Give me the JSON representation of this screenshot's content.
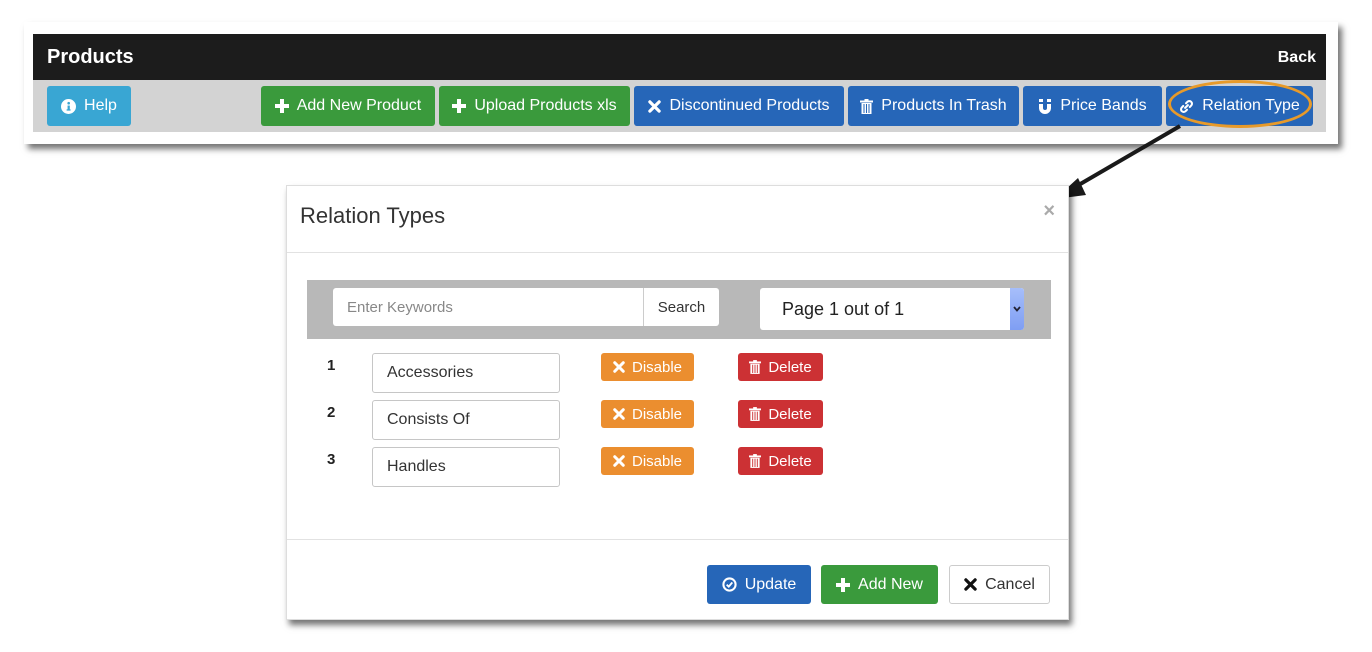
{
  "top": {
    "title": "Products",
    "back_label": "Back",
    "help_label": "Help",
    "toolbar": [
      {
        "label": "Add New Product",
        "icon": "plus-icon",
        "glyph": "✚",
        "style": "success"
      },
      {
        "label": "Upload Products xls",
        "icon": "plus-icon",
        "glyph": "✚",
        "style": "success"
      },
      {
        "label": "Discontinued Products",
        "icon": "close-icon",
        "glyph": "✖",
        "style": "primary"
      },
      {
        "label": "Products In Trash",
        "icon": "trash-icon",
        "glyph": "🗑",
        "style": "primary"
      },
      {
        "label": "Price Bands",
        "icon": "magnet-icon",
        "glyph": "Ü",
        "style": "primary"
      },
      {
        "label": "Relation Type",
        "icon": "link-icon",
        "glyph": "🔗",
        "style": "primary"
      }
    ]
  },
  "modal": {
    "title": "Relation Types",
    "close_glyph": "×",
    "search": {
      "placeholder": "Enter Keywords",
      "value": "",
      "button_label": "Search"
    },
    "pagination": {
      "selected": "Page 1 out of 1"
    },
    "rows": [
      {
        "num": "1",
        "value": "Accessories"
      },
      {
        "num": "2",
        "value": "Consists Of"
      },
      {
        "num": "3",
        "value": "Handles"
      }
    ],
    "row_actions": {
      "disable_label": "Disable",
      "delete_label": "Delete"
    },
    "footer": {
      "update_label": "Update",
      "add_new_label": "Add New",
      "cancel_label": "Cancel"
    }
  },
  "annotation": {
    "highlight_color": "#e79a2a",
    "target": "Relation Type"
  },
  "colors": {
    "header_bg": "#1c1c1c",
    "info": "#39a6d3",
    "success": "#3a9a3c",
    "primary": "#2666b8",
    "warning": "#eb8e2f",
    "danger": "#cc3134"
  }
}
